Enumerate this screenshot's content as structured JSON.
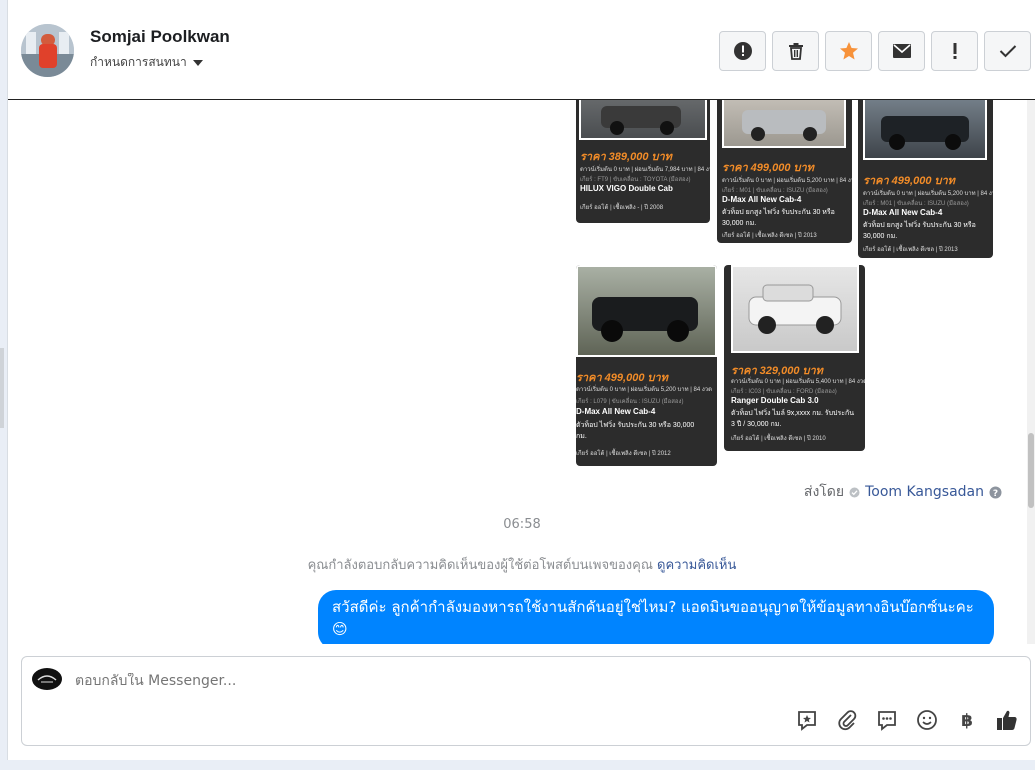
{
  "header": {
    "name": "Somjai Poolkwan",
    "assign_label": "กำหนดการสนทนา"
  },
  "toolbar": {
    "buttons": [
      "alert-circle-icon",
      "trash-icon",
      "star-icon",
      "envelope-icon",
      "exclamation-icon",
      "check-icon"
    ]
  },
  "cards": [
    {
      "price": "ราคา 389,000 บาท",
      "spec": "ดาวน์เริ่มต้น 0 บาท | ผ่อนเริ่มต้น 7,984 บาท | 84 งวด",
      "info": "เกียร์ : FT9 | ขับเคลื่อน : TOYOTA (มือสอง)",
      "model": "HILUX VIGO Double Cab",
      "desc": "",
      "foot": "เกียร์ ออโต้ | เชื้อเพลิง - | ปี 2008"
    },
    {
      "price": "ราคา 499,000 บาท",
      "spec": "ดาวน์เริ่มต้น 0 บาท | ผ่อนเริ่มต้น 5,200 บาท | 84 งวด",
      "info": "เกียร์ : M01 | ขับเคลื่อน : ISUZU (มือสอง)",
      "model": "D-Max All New Cab-4",
      "desc": "ตัวท็อป ยกสูง ไฟวิ่ง รับประกัน 30 หรือ 30,000 กม.",
      "foot": "เกียร์ ออโต้ | เชื้อเพลิง ดีเซล | ปี 2013"
    },
    {
      "price": "ราคา 499,000 บาท",
      "spec": "ดาวน์เริ่มต้น 0 บาท | ผ่อนเริ่มต้น 5,200 บาท | 84 งวด",
      "info": "เกียร์ : M01 | ขับเคลื่อน : ISUZU (มือสอง)",
      "model": "D-Max All New Cab-4",
      "desc": "ตัวท็อป ยกสูง ไฟวิ่ง รับประกัน 30 หรือ 30,000 กม.",
      "foot": "เกียร์ ออโต้ | เชื้อเพลิง ดีเซล | ปี 2013"
    },
    {
      "price": "ราคา 499,000 บาท",
      "spec": "ดาวน์เริ่มต้น 0 บาท | ผ่อนเริ่มต้น 5,200 บาท | 84 งวด",
      "info": "เกียร์ : L079 | ขับเคลื่อน : ISUZU (มือสอง)",
      "model": "D-Max All New Cab-4",
      "desc": "ตัวท็อป ไฟวิ่ง รับประกัน 30 หรือ 30,000 กม.",
      "foot": "เกียร์ ออโต้ | เชื้อเพลิง ดีเซล | ปี 2012"
    },
    {
      "price": "ราคา 329,000 บาท",
      "spec": "ดาวน์เริ่มต้น 0 บาท | ผ่อนเริ่มต้น 5,400 บาท | 84 งวด",
      "info": "เกียร์ : IC03 | ขับเคลื่อน : FORD (มือสอง)",
      "model": "Ranger Double Cab 3.0",
      "desc": "ตัวท็อป ไฟวิ่ง ไมล์ 9x,xxxx กม. รับประกัน 3 ปี / 30,000 กม.",
      "foot": "เกียร์ ออโต้ | เชื้อเพลิง ดีเซล | ปี 2010"
    }
  ],
  "sent_by": {
    "label": "ส่งโดย",
    "sender": "Toom Kangsadan"
  },
  "time": "06:58",
  "notice": {
    "text": "คุณกำลังตอบกลับความคิดเห็นของผู้ใช้ต่อโพสต์บนเพจของคุณ",
    "link": "ดูความคิดเห็น"
  },
  "message": "สวัสดีค่ะ ลูกค้ากำลังมองหารถใช้งานสักคันอยู่ใช่ไหม? แอดมินขออนุญาตให้ข้อมูลทางอินบ๊อกซ์นะคะ 😊",
  "composer": {
    "placeholder": "ตอบกลับใน Messenger..."
  }
}
